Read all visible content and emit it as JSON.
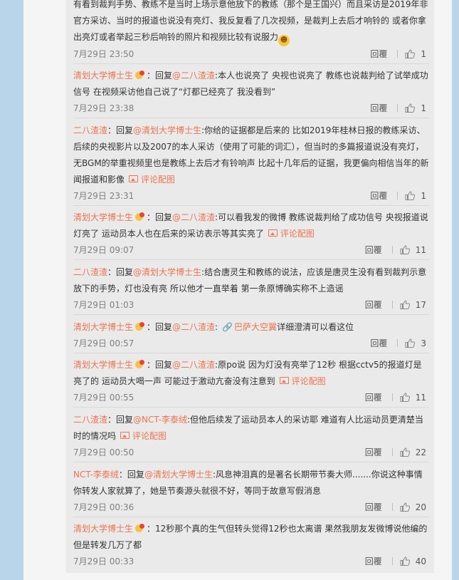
{
  "comments": [
    {
      "lines_html_parts": [],
      "text": "有看到裁判手势、教练不是当时上场示意他放下的教练（那个是王国兴）而且采访是2019年非官方采访、当时的报道也说没有亮灯、我反复看了几次视频，是裁判上去后才响铃的 或者你拿出亮灯或者举起三秒后响铃的照片和视频比较有说服力",
      "emoji": "😄",
      "time": "7月29日 23:50",
      "reply": "回覆",
      "likes": "1"
    },
    {
      "author": "清划大学博士生",
      "reply_prefix": "：回复",
      "mention": "@二八渣渣",
      "text": ":本人也说亮了 央视也说亮了 教练也说裁判给了试举成功信号 在视频采访他自己说了“灯都已经亮了 我没看到”",
      "time": "7月29日 23:38",
      "reply": "回覆",
      "likes": "1"
    },
    {
      "author": "二八渣渣",
      "reply_prefix": "：回复",
      "mention": "@清划大学博士生",
      "text": ":你给的证据都是后来的 比如2019年桂林日报的教练采访、后续的央视影片以及2007的本人采访（使用了可能的词汇），但当时的多篇报道说没有亮灯，无BGM的举重视频里也是教练上去后才有铃响声 比起十几年后的证据，我更偏向相信当年的新闻报道和影像",
      "image_link": "评论配图",
      "time": "7月29日 23:31",
      "reply": "回覆",
      "likes": "1"
    },
    {
      "author": "清划大学博士生",
      "reply_prefix": "：回复",
      "mention": "@二八渣渣",
      "text": ":可以看我发的微博 教练说裁判给了成功信号 央视报道说灯亮了 运动员本人也在后来的采访表示等其实亮了",
      "image_link": "评论配图",
      "time": "7月29日 09:07",
      "reply": "回覆",
      "likes": "11"
    },
    {
      "author": "二八渣渣",
      "reply_prefix": "：回复",
      "mention": "@清划大学博士生",
      "text": ":结合唐灵生和教练的说法，应该是唐灵生没有看到裁判示意放下的手势，灯也没有亮 所以他才一直举着 第一条原博确实称不上造谣",
      "time": "7月29日 01:03",
      "reply": "回覆",
      "likes": "17"
    },
    {
      "author": "清划大学博士生",
      "reply_prefix": "：回复",
      "mention": "@二八渣渣",
      "text": ":",
      "link_text": "巴萨大空翼",
      "text_after": "详细澄清可以看这位",
      "time": "7月29日 00:57",
      "reply": "回覆",
      "likes": "3"
    },
    {
      "author": "清划大学博士生",
      "reply_prefix": "：回复",
      "mention": "@二八渣渣",
      "text": ":原po说 因为灯没有亮举了12秒 根据cctv5的报道灯是亮了的 运动员大喝一声 可能过于激动亢奋没有注意到",
      "image_link": "评论配图",
      "time": "7月29日 00:55",
      "reply": "回覆",
      "likes": "11"
    },
    {
      "author": "二八渣渣",
      "reply_prefix": "：回复",
      "mention": "@NCT-李泰绒",
      "text": ":但他后续发了运动员本人的采访耶 难道有人比运动员更清楚当时的情况吗",
      "image_link": "评论配图",
      "time": "7月29日 00:50",
      "reply": "回覆",
      "likes": "22"
    },
    {
      "author": "NCT-李泰绒",
      "reply_prefix": "：回复",
      "mention": "@清划大学博士生",
      "text": ":风息神泪真的是著名长期带节奏大师.......你说这种事情你转发人家就算了，她是节奏源头就很不好，等同于故意写假消息",
      "time": "7月29日 00:36",
      "reply": "回覆",
      "likes": "20"
    },
    {
      "author": "清划大学博士生",
      "text": "：12秒那个真的生气但转头觉得12秒也太离谱 果然我朋友发微博说他编的 但是转发几万了都",
      "time": "7月29日 00:33",
      "reply": "回覆",
      "likes": "40"
    }
  ],
  "colors": {
    "accent": "#eb7350",
    "background": "#b8d5ea",
    "thread_bg": "#eaeaea"
  }
}
